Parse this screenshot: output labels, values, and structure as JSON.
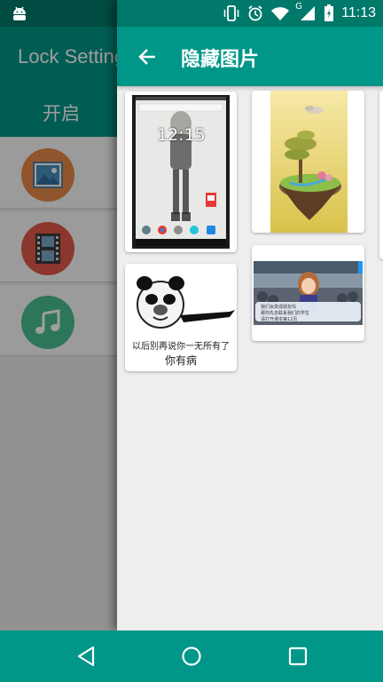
{
  "status_bar": {
    "time": "11:13",
    "network": "G",
    "icons": [
      "android-notification-icon",
      "vibrate-icon",
      "alarm-icon",
      "wifi-icon",
      "signal-icon",
      "battery-icon"
    ]
  },
  "background_app": {
    "title": "Lock Settings",
    "subbar_label": "开启",
    "rows": [
      {
        "icon": "image-icon",
        "color": "#e8894a"
      },
      {
        "icon": "film-icon",
        "color": "#e05a4a"
      },
      {
        "icon": "music-icon",
        "color": "#4bbf91"
      }
    ]
  },
  "drawer": {
    "title": "隐藏图片",
    "back_icon": "arrow-left-icon",
    "images": [
      {
        "name": "phone-screenshot",
        "clock": "12:15"
      },
      {
        "name": "floating-island-art"
      },
      {
        "name": "panda-meme",
        "line1": "以后别再说你一无所有了",
        "line2": "你有病"
      },
      {
        "name": "anime-game-screenshot",
        "dialog_line1": "我们会变成朋友吗",
        "dialog_line2": "那你先去联系我们的学生",
        "dialog_line3": "请打开课本第12页"
      }
    ]
  },
  "nav_bar": {
    "back_icon": "triangle-back-icon",
    "home_icon": "circle-home-icon",
    "recents_icon": "square-recents-icon"
  },
  "colors": {
    "primary": "#009688",
    "primary_dark": "#00796b",
    "drawer_bg": "#eeeeee"
  }
}
